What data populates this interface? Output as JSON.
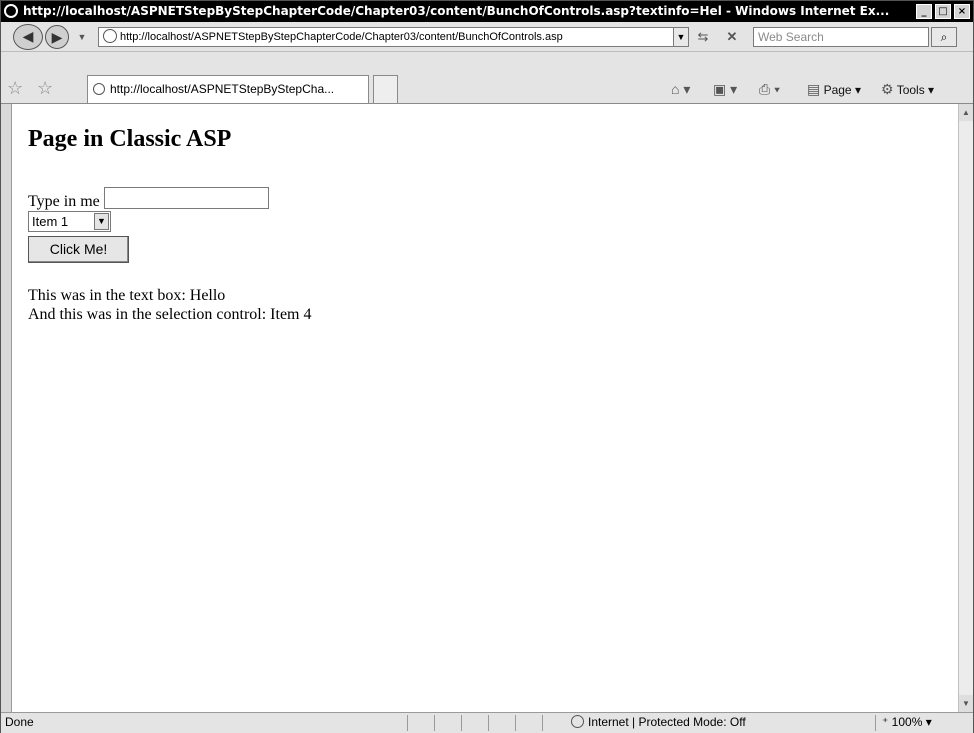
{
  "window": {
    "title": "http://localhost/ASPNETStepByStepChapterCode/Chapter03/content/BunchOfControls.asp?textinfo=Hel - Windows Internet Ex...",
    "minimize": "_",
    "maximize": "□",
    "close": "×"
  },
  "toolbar": {
    "address": "http://localhost/ASPNETStepByStepChapterCode/Chapter03/content/BunchOfControls.asp",
    "search_placeholder": "Web Search",
    "tab_title": "http://localhost/ASPNETStepByStepCha...",
    "page_label": "Page",
    "tools_label": "Tools"
  },
  "page": {
    "heading": "Page in Classic ASP",
    "textbox_label": "Type in me",
    "select_value": "Item 1",
    "button_label": "Click Me!",
    "result_text": "This was in the text box: Hello",
    "result_selection": "And this was in the selection control: Item 4"
  },
  "status": {
    "text": "Done",
    "zone": "Internet | Protected Mode: Off",
    "zoom": "100%"
  }
}
